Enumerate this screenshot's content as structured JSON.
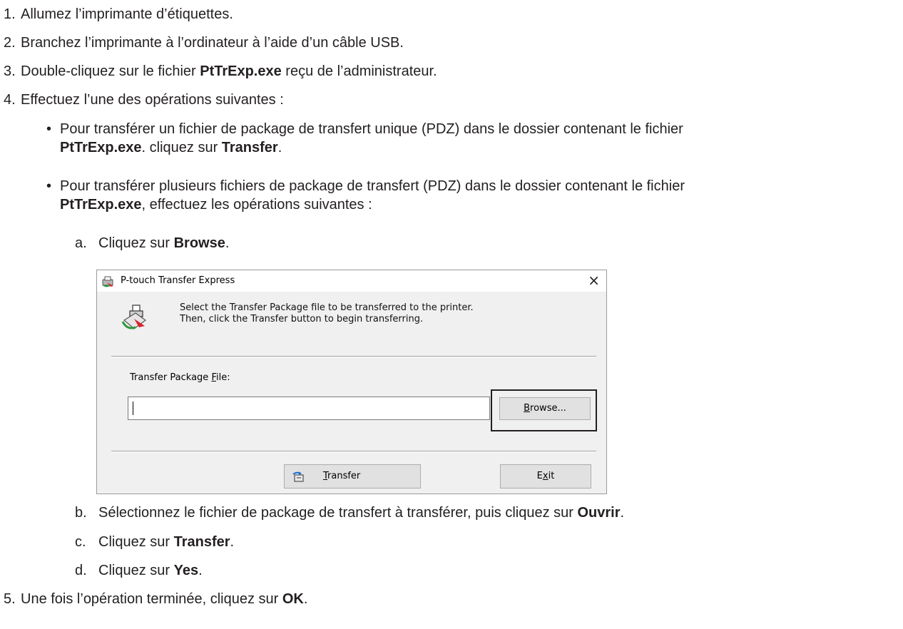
{
  "steps": [
    {
      "num": "1.",
      "text": "Allumez l’imprimante d’étiquettes."
    },
    {
      "num": "2.",
      "text": "Branchez l’imprimante à l’ordinateur à l’aide d’un câble USB."
    },
    {
      "num": "3.",
      "pre": "Double-cliquez sur le fichier ",
      "bold": "PtTrExp.exe",
      "post": " reçu de l’administrateur."
    },
    {
      "num": "4.",
      "text": "Effectuez l’une des opérations suivantes :"
    },
    {
      "num": "5.",
      "pre": "Une fois l’opération terminée, cliquez sur ",
      "bold": "OK",
      "post": "."
    }
  ],
  "bullets": [
    {
      "marker": "•",
      "line1": "Pour transférer un fichier de package de transfert unique (PDZ) dans le dossier contenant le fichier",
      "line2_bold1": "PtTrExp.exe",
      "line2_mid": ". cliquez sur ",
      "line2_bold2": "Transfer",
      "line2_post": "."
    },
    {
      "marker": "•",
      "line1": "Pour transférer plusieurs fichiers de package de transfert (PDZ) dans le dossier contenant le fichier",
      "line2_bold1": "PtTrExp.exe",
      "line2_post": ", effectuez les opérations suivantes :"
    }
  ],
  "substeps": [
    {
      "letter": "a.",
      "pre": "Cliquez sur ",
      "bold": "Browse",
      "post": "."
    },
    {
      "letter": "b.",
      "pre": "Sélectionnez le fichier de package de transfert à transférer, puis cliquez sur ",
      "bold": "Ouvrir",
      "post": "."
    },
    {
      "letter": "c.",
      "pre": "Cliquez sur ",
      "bold": "Transfer",
      "post": "."
    },
    {
      "letter": "d.",
      "pre": "Cliquez sur ",
      "bold": "Yes",
      "post": "."
    }
  ],
  "dialog": {
    "title": "P-touch Transfer Express",
    "close_icon": "×",
    "message_line1": "Select the Transfer Package file to be transferred to the printer.",
    "message_line2": "Then, click the Transfer  button to begin transferring.",
    "field_label_pre": "Transfer Package ",
    "field_label_key": "F",
    "field_label_post": "ile:",
    "file_value": "",
    "browse_key": "B",
    "browse_rest": "rowse...",
    "transfer_key": "T",
    "transfer_rest": "ransfer",
    "exit_pre": "E",
    "exit_key": "x",
    "exit_post": "it",
    "icons": {
      "title": "printer-transfer-icon",
      "message": "printer-transfer-icon",
      "transfer_button": "transfer-icon"
    },
    "colors": {
      "background": "#f0f0f0",
      "button": "#e1e1e1",
      "highlight_border": "#231f20"
    }
  }
}
